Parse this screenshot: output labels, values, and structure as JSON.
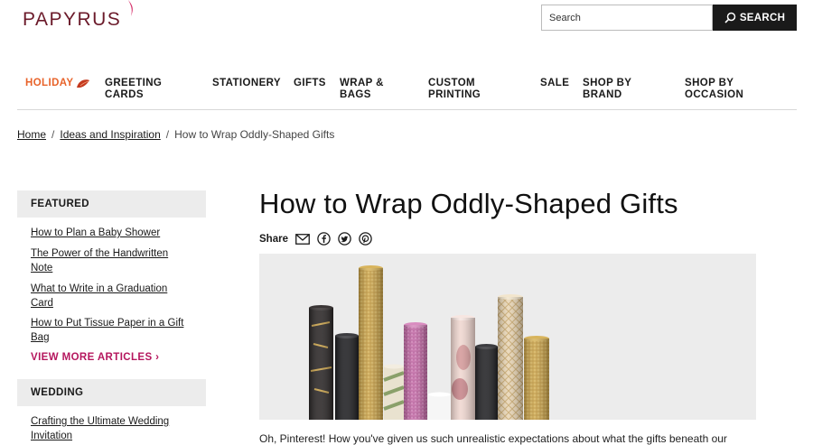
{
  "header": {
    "logo_text": "PAPYRUS",
    "search_placeholder": "Search",
    "search_button": "SEARCH"
  },
  "nav": {
    "items": [
      {
        "label": "HOLIDAY"
      },
      {
        "label": "GREETING CARDS"
      },
      {
        "label": "STATIONERY"
      },
      {
        "label": "GIFTS"
      },
      {
        "label": "WRAP & BAGS"
      },
      {
        "label": "CUSTOM PRINTING"
      },
      {
        "label": "SALE"
      },
      {
        "label": "SHOP BY BRAND"
      },
      {
        "label": "SHOP BY OCCASION"
      }
    ]
  },
  "breadcrumb": {
    "home": "Home",
    "ideas": "Ideas and Inspiration",
    "current": "How to Wrap Oddly-Shaped Gifts",
    "sep": "/"
  },
  "sidebar": {
    "featured_heading": "FEATURED",
    "featured_links": [
      {
        "label": "How to Plan a Baby Shower"
      },
      {
        "label": "The Power of the Handwritten Note"
      },
      {
        "label": "What to Write in a Graduation Card"
      },
      {
        "label": "How to Put Tissue Paper in a Gift Bag"
      }
    ],
    "view_more": "VIEW MORE ARTICLES ›",
    "wedding_heading": "WEDDING",
    "wedding_links": [
      {
        "label": "Crafting the Ultimate Wedding Invitation"
      }
    ]
  },
  "article": {
    "title": "How to Wrap Oddly-Shaped Gifts",
    "share_label": "Share",
    "intro": "Oh, Pinterest! How you've given us such unrealistic expectations about what the gifts beneath our"
  },
  "colors": {
    "accent_pink": "#b5175e",
    "holiday_orange": "#e8632a",
    "logo_maroon": "#6b1a2a"
  }
}
